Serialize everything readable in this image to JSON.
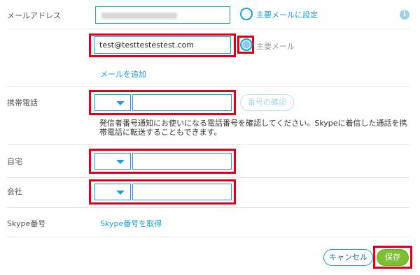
{
  "labels": {
    "email": "メールアドレス",
    "mobile": "携帯電話",
    "home": "自宅",
    "office": "会社",
    "skype_number": "Skype番号"
  },
  "email": {
    "primary_value": "",
    "set_primary_label": "主要メールに設定",
    "secondary_value": "test@testtestestest.com",
    "primary_mail_label": "主要メール",
    "add_email_link": "メールを追加"
  },
  "mobile": {
    "verify_button": "番号の確認",
    "description": "発信者番号通知にお使いになる電話番号を確認してください。Skypeに着信した通話を携帯電話に転送することもできます。"
  },
  "skype_number": {
    "get_link": "Skype番号を取得"
  },
  "footer": {
    "cancel_label": "キャンセル",
    "save_label": "保存"
  },
  "icons": {
    "info": "info-icon",
    "dropdown": "chevron-down-icon"
  },
  "colors": {
    "accent": "#1aa1d8",
    "highlight": "#e0001b",
    "save": "#7cc134"
  }
}
